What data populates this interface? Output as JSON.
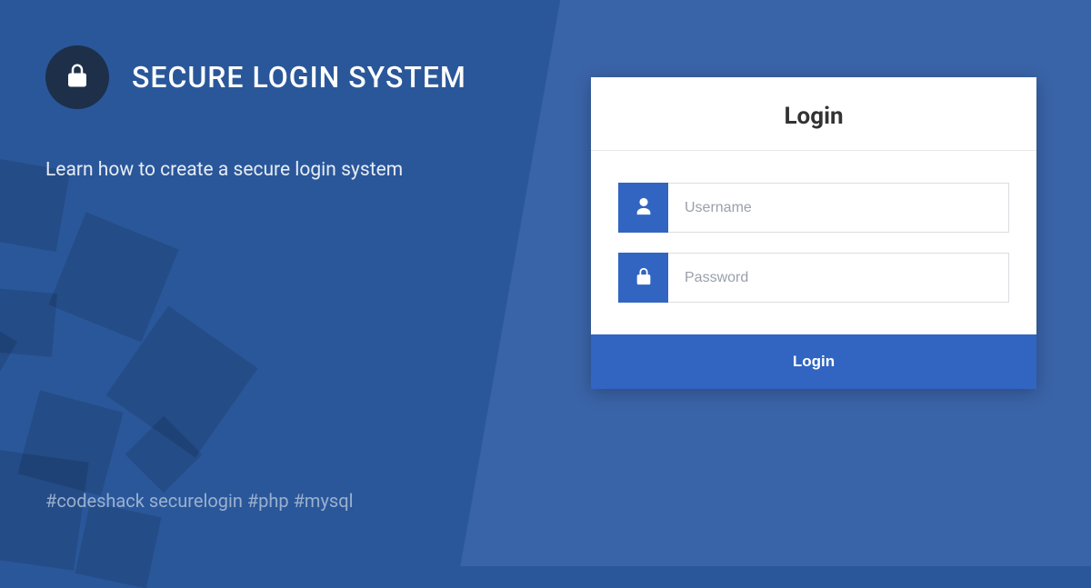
{
  "brand": {
    "title": "SECURE LOGIN SYSTEM"
  },
  "subtitle": "Learn how to create a secure login system",
  "tags": "#codeshack securelogin #php #mysql",
  "login": {
    "heading": "Login",
    "username_placeholder": "Username",
    "password_placeholder": "Password",
    "submit_label": "Login"
  }
}
